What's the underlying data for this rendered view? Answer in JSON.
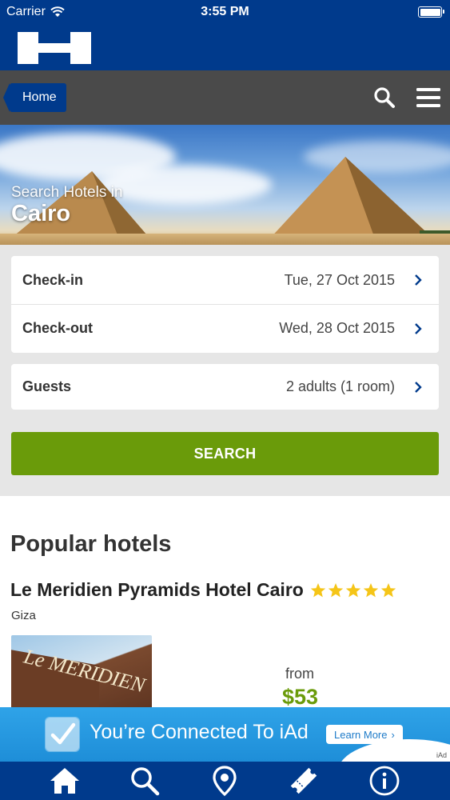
{
  "status_bar": {
    "carrier": "Carrier",
    "time": "3:55 PM"
  },
  "nav": {
    "home_label": "Home"
  },
  "hero": {
    "subtitle": "Search Hotels in",
    "city": "Cairo"
  },
  "form": {
    "checkin": {
      "label": "Check-in",
      "value": "Tue, 27 Oct 2015"
    },
    "checkout": {
      "label": "Check-out",
      "value": "Wed, 28 Oct 2015"
    },
    "guests": {
      "label": "Guests",
      "value": "2 adults (1 room)"
    },
    "search_label": "SEARCH"
  },
  "popular": {
    "title": "Popular hotels",
    "hotel": {
      "name": "Le Meridien Pyramids Hotel Cairo",
      "rating": 5,
      "location": "Giza",
      "from_label": "from",
      "price": "$53"
    }
  },
  "ad": {
    "text": "You’re Connected To iAd",
    "button": "Learn More",
    "tag": "iAd"
  },
  "tabs": [
    "home-icon",
    "search-icon",
    "location-pin-icon",
    "ticket-icon",
    "info-icon"
  ],
  "colors": {
    "brand_blue": "#003a8c",
    "nav_gray": "#4a4a4a",
    "search_green": "#6a9b0a",
    "star_gold": "#f5c518",
    "ad_blue": "#2fa3e8"
  }
}
